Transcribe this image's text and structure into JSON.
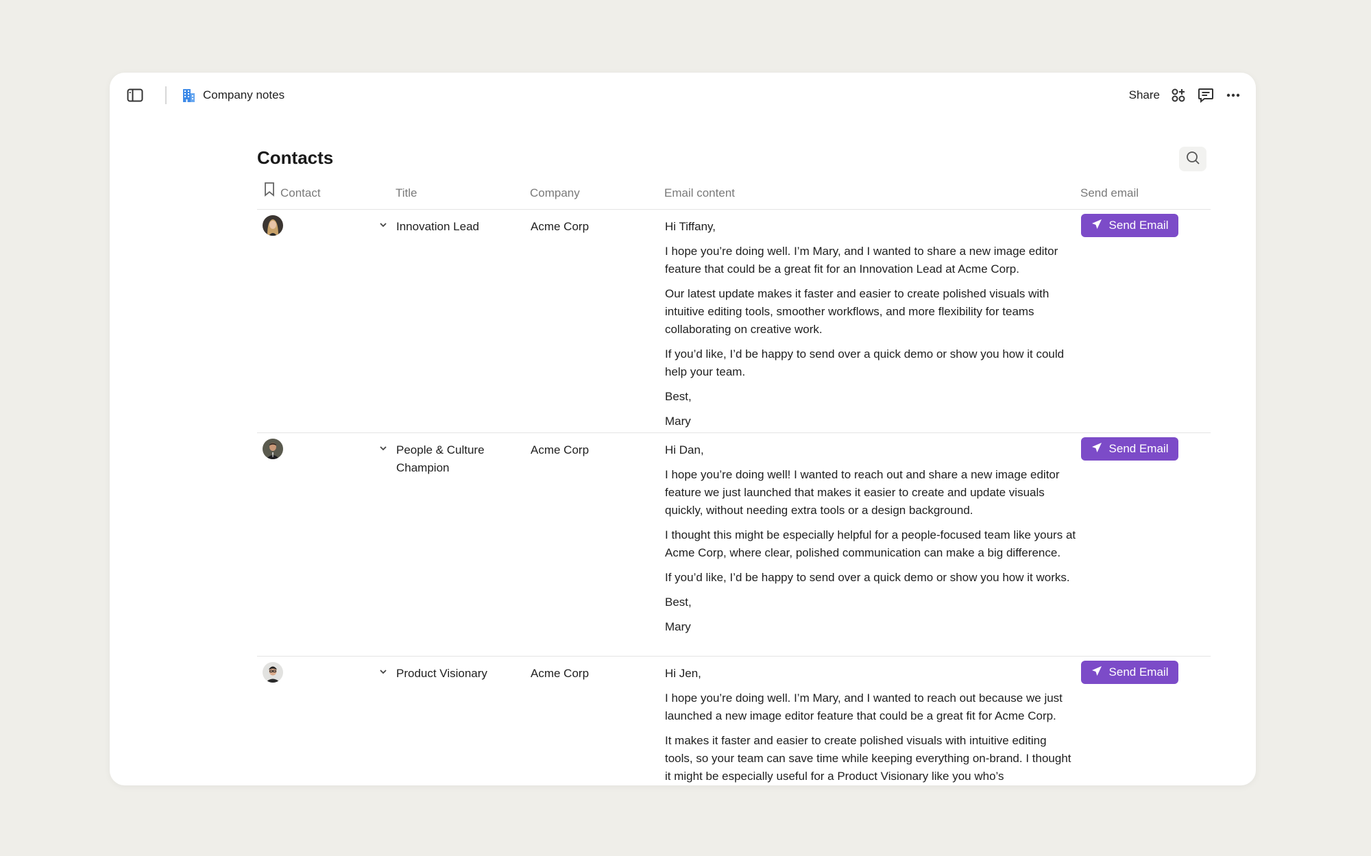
{
  "header": {
    "doc_title": "Company notes",
    "share_label": "Share",
    "icons": [
      "sidebar-toggle-icon",
      "building-icon",
      "apps-icon",
      "comment-icon",
      "more-icon"
    ]
  },
  "page": {
    "title": "Contacts",
    "accent_color": "#7c4bc8"
  },
  "table": {
    "columns": {
      "contact": "Contact",
      "title": "Title",
      "company": "Company",
      "email_content": "Email content",
      "send_email": "Send email"
    },
    "send_label": "Send Email",
    "rows": [
      {
        "title": "Innovation Lead",
        "company": "Acme Corp",
        "email": [
          "Hi Tiffany,",
          "I hope you’re doing well. I’m Mary, and I wanted to share a new image editor feature that could be a great fit for an Innovation Lead at Acme Corp.",
          "Our latest update makes it faster and easier to create polished visuals with intuitive editing tools, smoother workflows, and more flexibility for teams collaborating on creative work.",
          "If you’d like, I’d be happy to send over a quick demo or show you how it could help your team.",
          "Best,",
          "Mary"
        ]
      },
      {
        "title": "People & Culture Champion",
        "company": "Acme Corp",
        "email": [
          "Hi Dan,",
          "I hope you’re doing well! I wanted to reach out and share a new image editor feature we just launched that makes it easier to create and update visuals quickly, without needing extra tools or a design background.",
          "I thought this might be especially helpful for a people-focused team like yours at Acme Corp, where clear, polished communication can make a big difference.",
          "If you’d like, I’d be happy to send over a quick demo or show you how it works.",
          "Best,",
          "Mary"
        ]
      },
      {
        "title": "Product Visionary",
        "company": "Acme Corp",
        "email": [
          "Hi Jen,",
          "I hope you’re doing well. I’m Mary, and I wanted to reach out because we just launched a new image editor feature that could be a great fit for Acme Corp.",
          "It makes it faster and easier to create polished visuals with intuitive editing tools, so your team can save time while keeping everything on-brand. I thought it might be especially useful for a Product Visionary like you who’s"
        ]
      }
    ]
  }
}
